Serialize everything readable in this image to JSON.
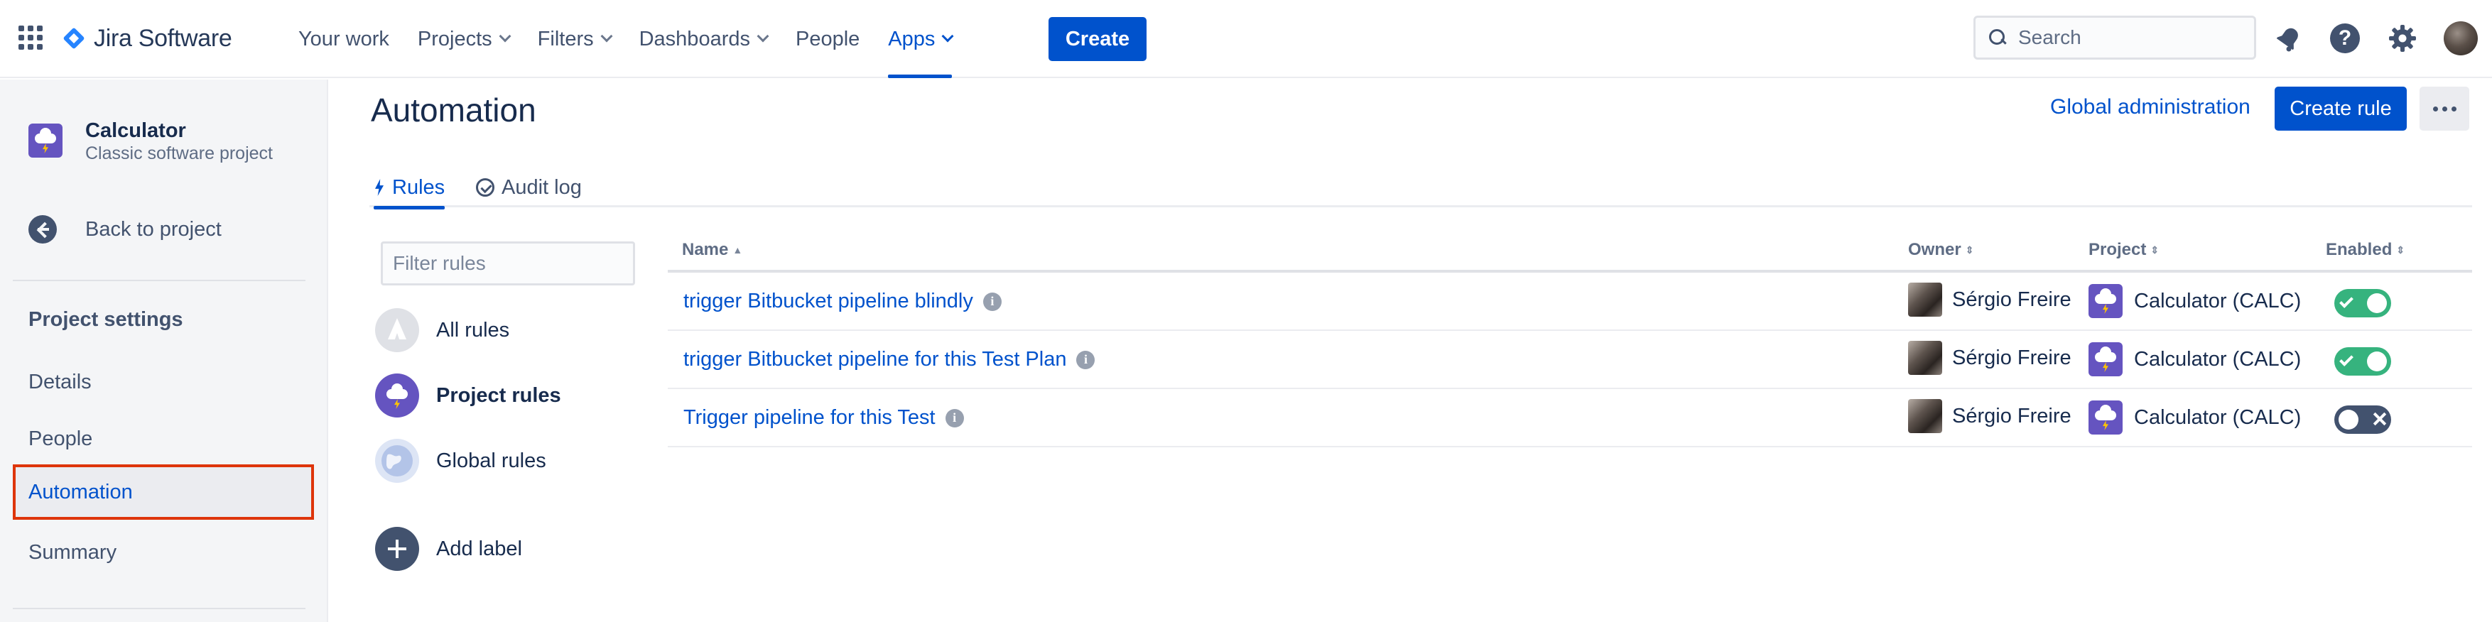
{
  "app": {
    "name": "Jira Software",
    "colors": {
      "primary": "#0052cc",
      "enabled": "#36b37e",
      "disabled": "#42526e",
      "highlight_border": "#de350b"
    }
  },
  "topnav": {
    "items": [
      {
        "label": "Your work",
        "has_dropdown": false
      },
      {
        "label": "Projects",
        "has_dropdown": true
      },
      {
        "label": "Filters",
        "has_dropdown": true
      },
      {
        "label": "Dashboards",
        "has_dropdown": true
      },
      {
        "label": "People",
        "has_dropdown": false
      },
      {
        "label": "Apps",
        "has_dropdown": true,
        "active": true
      }
    ],
    "create_label": "Create",
    "search_placeholder": "Search",
    "icons": [
      "notifications-icon",
      "help-icon",
      "settings-icon",
      "user-avatar"
    ]
  },
  "sidebar": {
    "project_name": "Calculator",
    "project_type": "Classic software project",
    "back_label": "Back to project",
    "section_heading": "Project settings",
    "items": [
      {
        "label": "Details"
      },
      {
        "label": "People"
      },
      {
        "label": "Automation",
        "selected": true
      },
      {
        "label": "Summary"
      }
    ]
  },
  "main": {
    "title": "Automation",
    "global_admin_label": "Global administration",
    "create_rule_label": "Create rule",
    "tabs": [
      {
        "label": "Rules",
        "active": true,
        "icon": "lightning-icon"
      },
      {
        "label": "Audit log",
        "active": false,
        "icon": "check-circle-icon"
      }
    ],
    "filter_placeholder": "Filter rules",
    "rule_filters": [
      {
        "label": "All rules"
      },
      {
        "label": "Project rules",
        "active": true
      },
      {
        "label": "Global rules"
      }
    ],
    "add_label": "Add label",
    "table": {
      "columns": [
        "Name",
        "Owner",
        "Project",
        "Enabled"
      ],
      "rows": [
        {
          "name": "trigger Bitbucket pipeline blindly",
          "owner": "Sérgio Freire",
          "project": "Calculator (CALC)",
          "enabled": true
        },
        {
          "name": "trigger Bitbucket pipeline for this Test Plan",
          "owner": "Sérgio Freire",
          "project": "Calculator (CALC)",
          "enabled": true
        },
        {
          "name": "Trigger pipeline for this Test",
          "owner": "Sérgio Freire",
          "project": "Calculator (CALC)",
          "enabled": false
        }
      ]
    }
  }
}
